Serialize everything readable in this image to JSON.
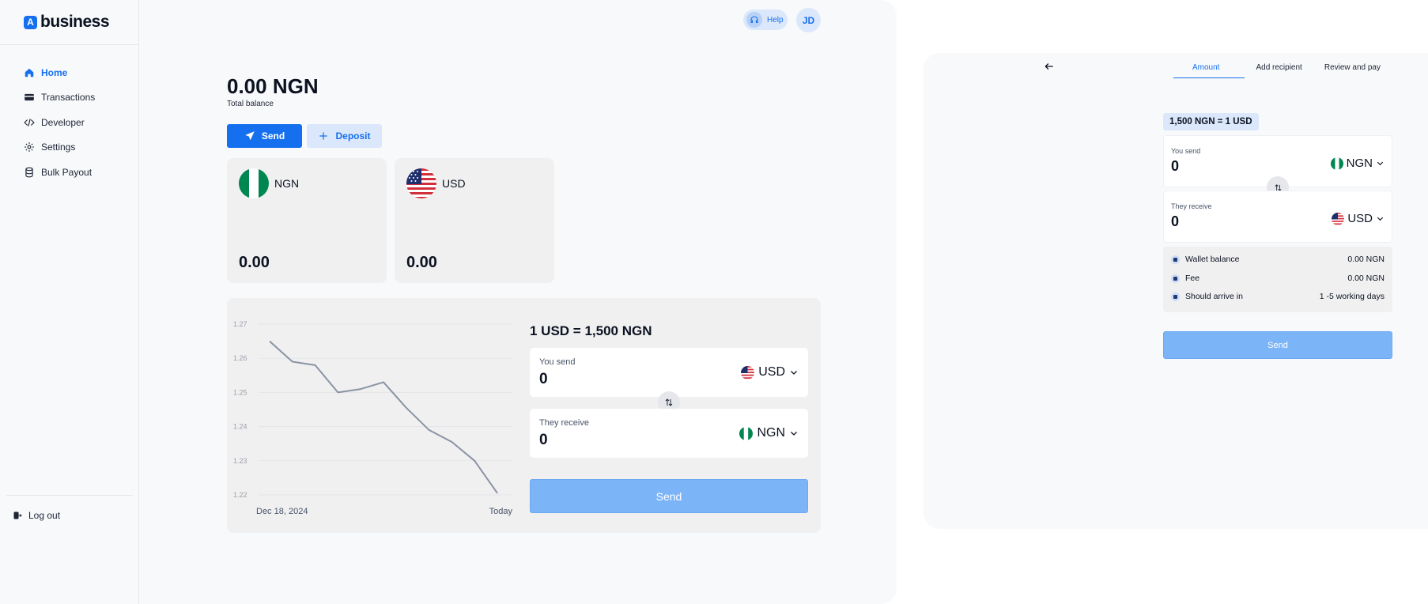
{
  "brand": {
    "name": "business",
    "mark": "A"
  },
  "sidebar": {
    "items": [
      {
        "label": "Home",
        "active": true
      },
      {
        "label": "Transactions"
      },
      {
        "label": "Developer"
      },
      {
        "label": "Settings"
      },
      {
        "label": "Bulk Payout"
      }
    ],
    "logout_label": "Log out"
  },
  "header": {
    "help_label": "Help",
    "avatar_initials": "JD"
  },
  "overview": {
    "balance": "0.00 NGN",
    "balance_label": "Total balance",
    "send_label": "Send",
    "deposit_label": "Deposit"
  },
  "wallets": [
    {
      "code": "NGN",
      "amount": "0.00",
      "flag": "ng-flag-icon"
    },
    {
      "code": "USD",
      "amount": "0.00",
      "flag": "us-flag-icon"
    }
  ],
  "converter": {
    "rate": "1 USD = 1,500 NGN",
    "send": {
      "label": "You send",
      "value": "0",
      "currency": "USD"
    },
    "receive": {
      "label": "They receive",
      "value": "0",
      "currency": "NGN"
    },
    "button_label": "Send"
  },
  "chart_data": {
    "type": "line",
    "series": [
      {
        "values": [
          1.265,
          1.259,
          1.258,
          1.25,
          1.251,
          1.253,
          1.2455,
          1.239,
          1.2355,
          1.23,
          1.2205
        ]
      }
    ],
    "x_labels": [
      "Dec 18, 2024",
      "Today"
    ],
    "yticks": [
      1.27,
      1.26,
      1.25,
      1.24,
      1.23,
      1.22
    ],
    "ylim": [
      1.22,
      1.27
    ],
    "grid": true
  },
  "flow": {
    "steps": [
      {
        "label": "Amount",
        "active": true
      },
      {
        "label": "Add recipient"
      },
      {
        "label": "Review and pay"
      }
    ],
    "rate": "1,500 NGN = 1 USD",
    "send": {
      "label": "You send",
      "value": "0",
      "currency": "NGN"
    },
    "receive": {
      "label": "They receive",
      "value": "0",
      "currency": "USD"
    },
    "summary": [
      {
        "label": "Wallet balance",
        "value": "0.00 NGN"
      },
      {
        "label": "Fee",
        "value": "0.00 NGN"
      },
      {
        "label": "Should arrive in",
        "value": "1 -5 working days"
      }
    ],
    "button_label": "Send"
  },
  "colors": {
    "primary": "#1570ef",
    "primary_light": "#dbe7fb",
    "disabled": "#7cb4f8",
    "ng_green": "#008751"
  }
}
